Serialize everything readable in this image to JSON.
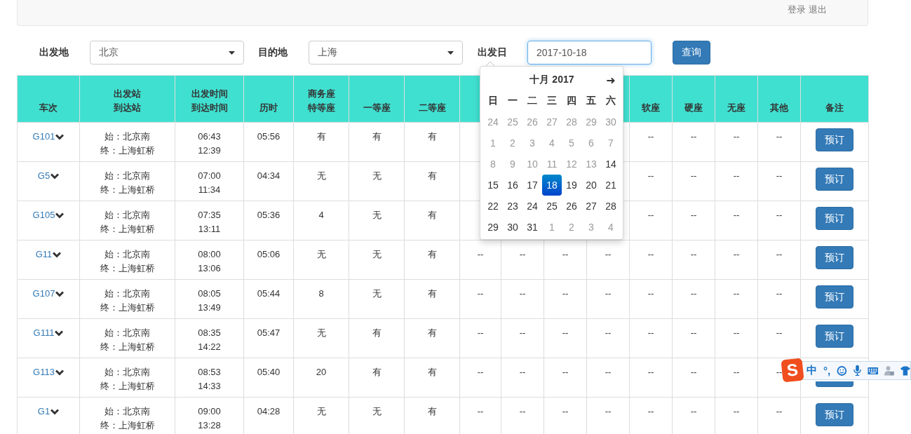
{
  "top_bar": {
    "links": [
      "登录",
      "退出"
    ]
  },
  "search": {
    "from_label": "出发地",
    "from_value": "北京",
    "to_label": "目的地",
    "to_value": "上海",
    "date_label": "出发日",
    "date_value": "2017-10-18",
    "button": "查询"
  },
  "table": {
    "columns_left": [
      [
        "车次"
      ],
      [
        "出发站",
        "到达站"
      ],
      [
        "出发时间",
        "到达时间"
      ],
      [
        "历时"
      ],
      [
        "商务座",
        "特等座"
      ],
      [
        "一等座"
      ],
      [
        "二等座"
      ]
    ],
    "columns_right": [
      [
        "软座"
      ],
      [
        "硬座"
      ],
      [
        "无座"
      ],
      [
        "其他"
      ],
      [
        "备注"
      ]
    ],
    "rows": [
      {
        "train": "G101",
        "stations": [
          "始：北京南",
          "终：上海虹桥"
        ],
        "times": [
          "06:43",
          "12:39"
        ],
        "duration": "05:56",
        "seats": [
          "有",
          "有",
          "有"
        ],
        "other_seats": [
          "--",
          "--",
          "--",
          "--"
        ],
        "action": "预订"
      },
      {
        "train": "G5",
        "stations": [
          "始：北京南",
          "终：上海虹桥"
        ],
        "times": [
          "07:00",
          "11:34"
        ],
        "duration": "04:34",
        "seats": [
          "无",
          "无",
          "有"
        ],
        "other_seats": [
          "--",
          "--",
          "--",
          "--"
        ],
        "action": "预订"
      },
      {
        "train": "G105",
        "stations": [
          "始：北京南",
          "终：上海虹桥"
        ],
        "times": [
          "07:35",
          "13:11"
        ],
        "duration": "05:36",
        "seats": [
          "4",
          "无",
          "有"
        ],
        "other_seats": [
          "--",
          "--",
          "--",
          "--"
        ],
        "action": "预订"
      },
      {
        "train": "G11",
        "stations": [
          "始：北京南",
          "终：上海虹桥"
        ],
        "times": [
          "08:00",
          "13:06"
        ],
        "duration": "05:06",
        "seats": [
          "无",
          "无",
          "有"
        ],
        "sleeper_seats": [
          "--",
          "--",
          "--",
          "--"
        ],
        "other_seats": [
          "--",
          "--",
          "--",
          "--"
        ],
        "action": "预订"
      },
      {
        "train": "G107",
        "stations": [
          "始：北京南",
          "终：上海虹桥"
        ],
        "times": [
          "08:05",
          "13:49"
        ],
        "duration": "05:44",
        "seats": [
          "8",
          "无",
          "有"
        ],
        "sleeper_seats": [
          "--",
          "--",
          "--",
          "--"
        ],
        "other_seats": [
          "--",
          "--",
          "--",
          "--"
        ],
        "action": "预订"
      },
      {
        "train": "G111",
        "stations": [
          "始：北京南",
          "终：上海虹桥"
        ],
        "times": [
          "08:35",
          "14:22"
        ],
        "duration": "05:47",
        "seats": [
          "无",
          "有",
          "有"
        ],
        "sleeper_seats": [
          "--",
          "--",
          "--",
          "--"
        ],
        "other_seats": [
          "--",
          "--",
          "--",
          "--"
        ],
        "action": "预订"
      },
      {
        "train": "G113",
        "stations": [
          "始：北京南",
          "终：上海虹桥"
        ],
        "times": [
          "08:53",
          "14:33"
        ],
        "duration": "05:40",
        "seats": [
          "20",
          "有",
          "有"
        ],
        "sleeper_seats": [
          "--",
          "--",
          "--",
          "--"
        ],
        "other_seats": [
          "--",
          "--",
          "--",
          "--"
        ]
      },
      {
        "train": "G1",
        "stations": [
          "始：北京南",
          "终：上海虹桥"
        ],
        "times": [
          "09:00",
          "13:28"
        ],
        "duration": "04:28",
        "seats": [
          "无",
          "无",
          "有"
        ],
        "sleeper_seats": [
          "--",
          "--",
          "--",
          "--"
        ],
        "other_seats": [
          "--",
          "--",
          "--",
          "--"
        ],
        "action": "预订"
      }
    ]
  },
  "datepicker": {
    "title": "十月 2017",
    "next": "➜",
    "weekdays": [
      "日",
      "一",
      "二",
      "三",
      "四",
      "五",
      "六"
    ],
    "weeks": [
      [
        {
          "day": "24",
          "muted": true,
          "selected": false
        },
        {
          "day": "25",
          "muted": true,
          "selected": false
        },
        {
          "day": "26",
          "muted": true,
          "selected": false
        },
        {
          "day": "27",
          "muted": true,
          "selected": false
        },
        {
          "day": "28",
          "muted": true,
          "selected": false
        },
        {
          "day": "29",
          "muted": true,
          "selected": false
        },
        {
          "day": "30",
          "muted": true,
          "selected": false
        }
      ],
      [
        {
          "day": "1",
          "muted": true,
          "selected": false
        },
        {
          "day": "2",
          "muted": true,
          "selected": false
        },
        {
          "day": "3",
          "muted": true,
          "selected": false
        },
        {
          "day": "4",
          "muted": true,
          "selected": false
        },
        {
          "day": "5",
          "muted": true,
          "selected": false
        },
        {
          "day": "6",
          "muted": true,
          "selected": false
        },
        {
          "day": "7",
          "muted": true,
          "selected": false
        }
      ],
      [
        {
          "day": "8",
          "muted": true,
          "selected": false
        },
        {
          "day": "9",
          "muted": true,
          "selected": false
        },
        {
          "day": "10",
          "muted": true,
          "selected": false
        },
        {
          "day": "11",
          "muted": true,
          "selected": false
        },
        {
          "day": "12",
          "muted": true,
          "selected": false
        },
        {
          "day": "13",
          "muted": true,
          "selected": false
        },
        {
          "day": "14",
          "muted": false,
          "selected": false
        }
      ],
      [
        {
          "day": "15",
          "muted": false,
          "selected": false
        },
        {
          "day": "16",
          "muted": false,
          "selected": false
        },
        {
          "day": "17",
          "muted": false,
          "selected": false
        },
        {
          "day": "18",
          "muted": false,
          "selected": true
        },
        {
          "day": "19",
          "muted": false,
          "selected": false
        },
        {
          "day": "20",
          "muted": false,
          "selected": false
        },
        {
          "day": "21",
          "muted": false,
          "selected": false
        }
      ],
      [
        {
          "day": "22",
          "muted": false,
          "selected": false
        },
        {
          "day": "23",
          "muted": false,
          "selected": false
        },
        {
          "day": "24",
          "muted": false,
          "selected": false
        },
        {
          "day": "25",
          "muted": false,
          "selected": false
        },
        {
          "day": "26",
          "muted": false,
          "selected": false
        },
        {
          "day": "27",
          "muted": false,
          "selected": false
        },
        {
          "day": "28",
          "muted": false,
          "selected": false
        }
      ],
      [
        {
          "day": "29",
          "muted": false,
          "selected": false
        },
        {
          "day": "30",
          "muted": false,
          "selected": false
        },
        {
          "day": "31",
          "muted": false,
          "selected": false
        },
        {
          "day": "1",
          "muted": true,
          "selected": false
        },
        {
          "day": "2",
          "muted": true,
          "selected": false
        },
        {
          "day": "3",
          "muted": true,
          "selected": false
        },
        {
          "day": "4",
          "muted": true,
          "selected": false
        }
      ]
    ]
  },
  "ime_bar": {
    "logo": "S",
    "mode": "中",
    "punctuation": "°,"
  }
}
